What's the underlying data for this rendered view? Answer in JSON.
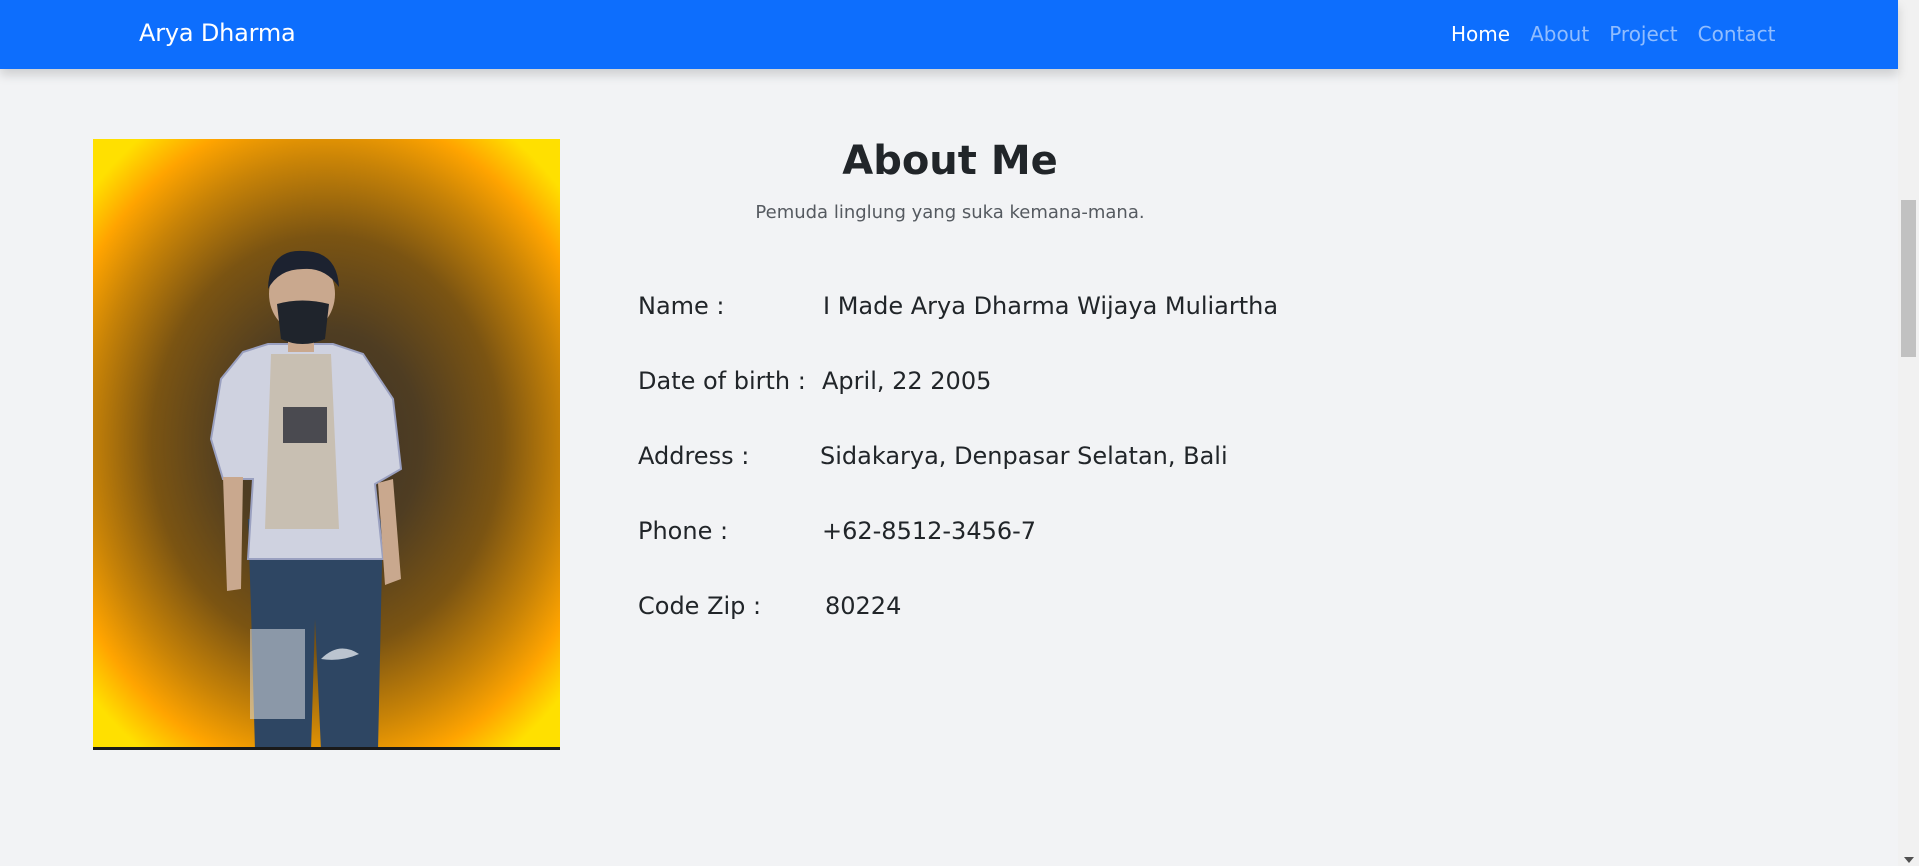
{
  "navbar": {
    "brand": "Arya Dharma",
    "links": [
      {
        "label": "Home",
        "active": true
      },
      {
        "label": "About",
        "active": false
      },
      {
        "label": "Project",
        "active": false
      },
      {
        "label": "Contact",
        "active": false
      }
    ]
  },
  "about": {
    "title": "About Me",
    "subtitle": "Pemuda linglung yang suka kemana-mana.",
    "fields": [
      {
        "label": "Name :",
        "value": "I Made Arya Dharma Wijaya Muliartha"
      },
      {
        "label": "Date of birth :",
        "value": "April, 22 2005"
      },
      {
        "label": "Address :",
        "value": "Sidakarya, Denpasar Selatan, Bali"
      },
      {
        "label": "Phone :",
        "value": "+62-8512-3456-7"
      },
      {
        "label": "Code Zip :",
        "value": "80224"
      }
    ]
  },
  "colors": {
    "navbar": "#0d6efd",
    "background": "#f2f3f5",
    "text": "#212529"
  }
}
